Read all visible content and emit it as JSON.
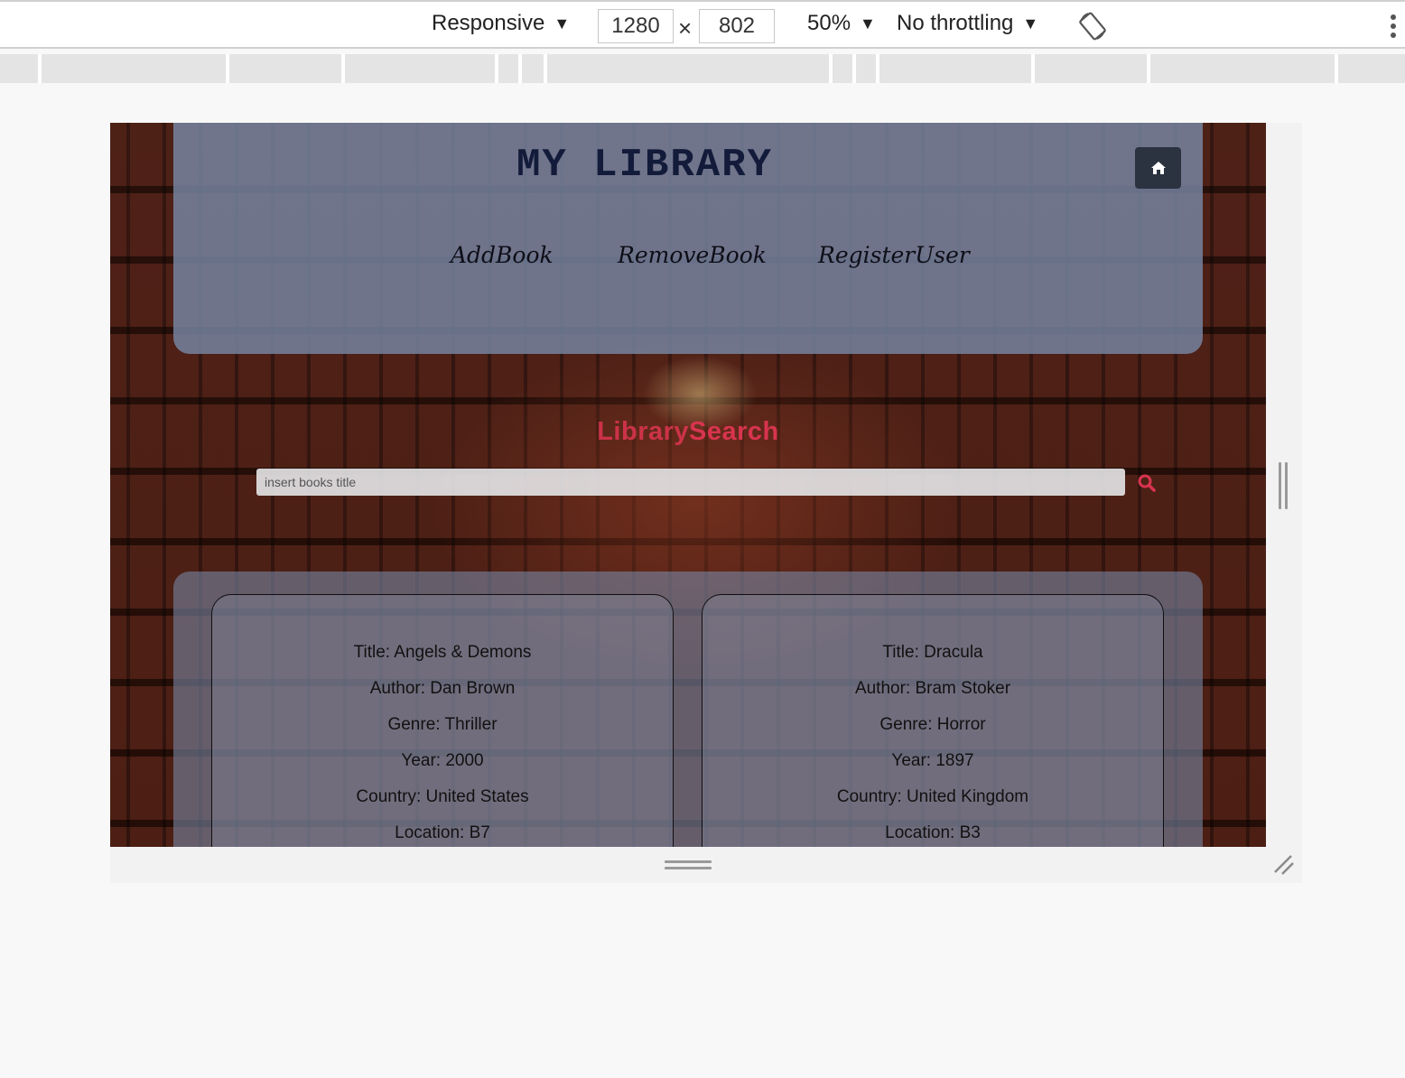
{
  "devtools": {
    "device": "Responsive",
    "width": "1280",
    "height": "802",
    "zoom": "50%",
    "throttling": "No throttling"
  },
  "page": {
    "title": "MY LIBRARY",
    "nav": [
      "AddBook",
      "RemoveBook",
      "RegisterUser"
    ],
    "search_heading_part1": "Library",
    "search_heading_part2": "Search",
    "search_placeholder": "insert books title",
    "colors": {
      "accent": "#d8344f",
      "title": "#131b3a",
      "home_button": "#2b3240"
    },
    "books": [
      {
        "title": "Title: Angels & Demons",
        "author": "Author: Dan Brown",
        "genre": "Genre: Thriller",
        "year": "Year: 2000",
        "country": "Country: United States",
        "location": "Location: B7"
      },
      {
        "title": "Title: Dracula",
        "author": "Author: Bram Stoker",
        "genre": "Genre: Horror",
        "year": "Year: 1897",
        "country": "Country: United Kingdom",
        "location": "Location: B3"
      }
    ]
  },
  "icons": {
    "home": "home-icon",
    "search": "search-icon",
    "rotate": "rotate-icon",
    "more": "more-vertical-icon"
  }
}
